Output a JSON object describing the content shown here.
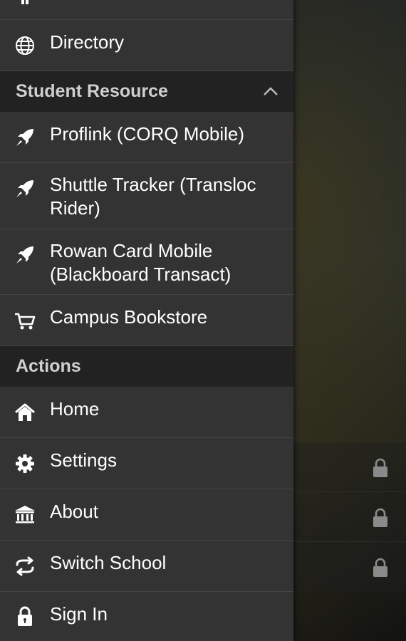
{
  "drawer": {
    "top_items": [
      {
        "label": "Directory",
        "icon": "globe-icon"
      }
    ],
    "sections": [
      {
        "title": "Student Resource",
        "collapse_icon": "chevron-up-icon",
        "items": [
          {
            "label": "Proflink (CORQ Mobile)",
            "icon": "rocket-icon"
          },
          {
            "label": "Shuttle Tracker (Transloc Rider)",
            "icon": "rocket-icon"
          },
          {
            "label": "Rowan Card Mobile (Blackboard Transact)",
            "icon": "rocket-icon"
          },
          {
            "label": "Campus Bookstore",
            "icon": "cart-icon"
          }
        ]
      },
      {
        "title": "Actions",
        "items": [
          {
            "label": "Home",
            "icon": "home-icon"
          },
          {
            "label": "Settings",
            "icon": "gear-icon"
          },
          {
            "label": "About",
            "icon": "bank-icon"
          },
          {
            "label": "Switch School",
            "icon": "swap-arrows-icon"
          },
          {
            "label": "Sign In",
            "icon": "lock-icon"
          }
        ]
      }
    ]
  },
  "background": {
    "locked_rows_icon": "lock-icon"
  },
  "colors": {
    "drawer_bg": "#333333",
    "section_bg": "#222222",
    "text": "#ffffff",
    "section_text": "#cfcfcf"
  }
}
